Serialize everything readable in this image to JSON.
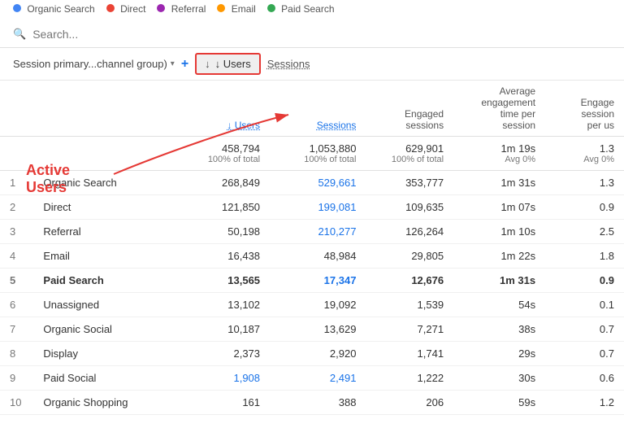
{
  "legend": {
    "items": [
      {
        "label": "Organic Search",
        "color": "#4285f4"
      },
      {
        "label": "Direct",
        "color": "#ea4335"
      },
      {
        "label": "Referral",
        "color": "#9c27b0"
      },
      {
        "label": "Email",
        "color": "#ff9800"
      },
      {
        "label": "Paid Search",
        "color": "#34a853"
      }
    ]
  },
  "search": {
    "placeholder": "Search..."
  },
  "filter": {
    "label": "Session primary...channel group)",
    "add_label": "+"
  },
  "columns": {
    "users_label": "↓ Users",
    "sessions_label": "Sessions",
    "engaged_sessions_label": "Engaged sessions",
    "avg_engagement_label": "Average engagement time per session",
    "engage_per_user_label": "Engage session per us"
  },
  "annotation": {
    "active_users": "Active Users"
  },
  "totals": {
    "users": "458,794",
    "users_pct": "100% of total",
    "sessions": "1,053,880",
    "sessions_pct": "100% of total",
    "engaged": "629,901",
    "engaged_pct": "100% of total",
    "avg_time": "1m 19s",
    "avg_time_sub": "Avg 0%",
    "engage_per": "1.3",
    "engage_per_sub": "Avg 0%"
  },
  "rows": [
    {
      "num": 1,
      "channel": "Organic Search",
      "users": "268,849",
      "sessions": "529,661",
      "engaged": "353,777",
      "avg_time": "1m 31s",
      "engage_per": "1.3",
      "bold": false,
      "users_blue": false,
      "sessions_blue": true
    },
    {
      "num": 2,
      "channel": "Direct",
      "users": "121,850",
      "sessions": "199,081",
      "engaged": "109,635",
      "avg_time": "1m 07s",
      "engage_per": "0.9",
      "bold": false,
      "users_blue": false,
      "sessions_blue": true
    },
    {
      "num": 3,
      "channel": "Referral",
      "users": "50,198",
      "sessions": "210,277",
      "engaged": "126,264",
      "avg_time": "1m 10s",
      "engage_per": "2.5",
      "bold": false,
      "users_blue": false,
      "sessions_blue": true
    },
    {
      "num": 4,
      "channel": "Email",
      "users": "16,438",
      "sessions": "48,984",
      "engaged": "29,805",
      "avg_time": "1m 22s",
      "engage_per": "1.8",
      "bold": false,
      "users_blue": false,
      "sessions_blue": false
    },
    {
      "num": 5,
      "channel": "Paid Search",
      "users": "13,565",
      "sessions": "17,347",
      "engaged": "12,676",
      "avg_time": "1m 31s",
      "engage_per": "0.9",
      "bold": true,
      "users_blue": false,
      "sessions_blue": true
    },
    {
      "num": 6,
      "channel": "Unassigned",
      "users": "13,102",
      "sessions": "19,092",
      "engaged": "1,539",
      "avg_time": "54s",
      "engage_per": "0.1",
      "bold": false,
      "users_blue": false,
      "sessions_blue": false
    },
    {
      "num": 7,
      "channel": "Organic Social",
      "users": "10,187",
      "sessions": "13,629",
      "engaged": "7,271",
      "avg_time": "38s",
      "engage_per": "0.7",
      "bold": false,
      "users_blue": false,
      "sessions_blue": false
    },
    {
      "num": 8,
      "channel": "Display",
      "users": "2,373",
      "sessions": "2,920",
      "engaged": "1,741",
      "avg_time": "29s",
      "engage_per": "0.7",
      "bold": false,
      "users_blue": false,
      "sessions_blue": false
    },
    {
      "num": 9,
      "channel": "Paid Social",
      "users": "1,908",
      "sessions": "2,491",
      "engaged": "1,222",
      "avg_time": "30s",
      "engage_per": "0.6",
      "bold": false,
      "users_blue": true,
      "sessions_blue": true
    },
    {
      "num": 10,
      "channel": "Organic Shopping",
      "users": "161",
      "sessions": "388",
      "engaged": "206",
      "avg_time": "59s",
      "engage_per": "1.2",
      "bold": false,
      "users_blue": false,
      "sessions_blue": false
    }
  ]
}
